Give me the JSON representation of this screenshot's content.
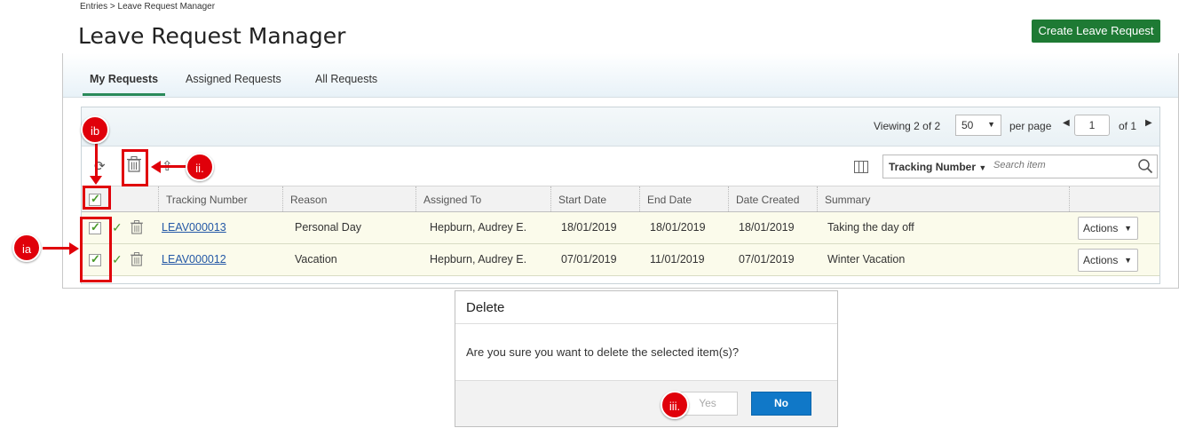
{
  "breadcrumb": "Entries > Leave Request Manager",
  "page_title": "Leave Request Manager",
  "create_button": "Create Leave Request",
  "tabs": [
    {
      "label": "My Requests",
      "active": true
    },
    {
      "label": "Assigned Requests",
      "active": false
    },
    {
      "label": "All Requests",
      "active": false
    }
  ],
  "pager": {
    "viewing_prefix": "Viewing",
    "viewing_count": "2 of 2",
    "per_page_value": "50",
    "per_page_label": "per page",
    "page_number": "1",
    "of_label": "of 1"
  },
  "search": {
    "field": "Tracking Number",
    "placeholder": "Search item"
  },
  "columns": [
    "Tracking Number",
    "Reason",
    "Assigned To",
    "Start Date",
    "End Date",
    "Date Created",
    "Summary"
  ],
  "rows": [
    {
      "tracking": "LEAV000013",
      "reason": "Personal Day",
      "assigned_to": "Hepburn, Audrey E.",
      "start": "18/01/2019",
      "end": "18/01/2019",
      "created": "18/01/2019",
      "summary": "Taking the day off",
      "actions": "Actions"
    },
    {
      "tracking": "LEAV000012",
      "reason": "Vacation",
      "assigned_to": "Hepburn, Audrey E.",
      "start": "07/01/2019",
      "end": "11/01/2019",
      "created": "07/01/2019",
      "summary": "Winter Vacation",
      "actions": "Actions"
    }
  ],
  "callouts": {
    "ia": "ia",
    "ib": "ib",
    "ii": "ii.",
    "iii": "iii."
  },
  "dialog": {
    "title": "Delete",
    "message": "Are you sure you want to delete the selected item(s)?",
    "yes": "Yes",
    "no": "No"
  },
  "colors": {
    "accent_green": "#1e7a34",
    "callout_red": "#e0000a",
    "primary_blue": "#1078c8",
    "link_blue": "#2458a6"
  }
}
